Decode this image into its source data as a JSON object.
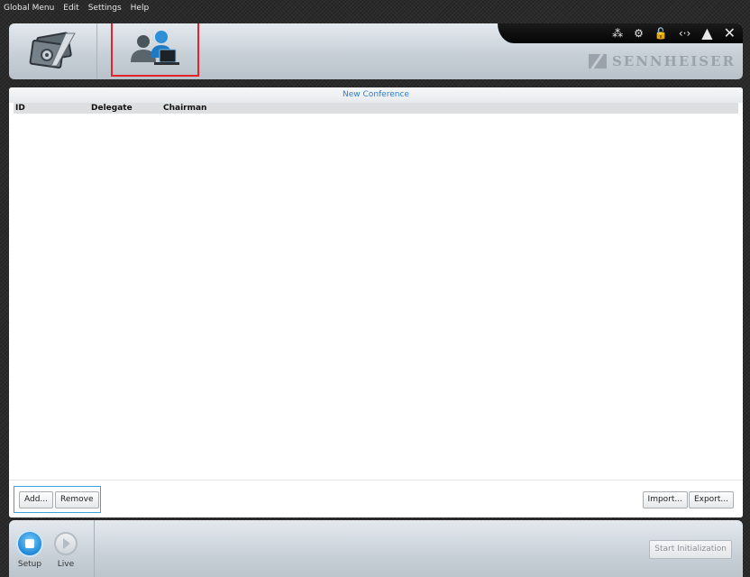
{
  "menu": [
    "Global Menu",
    "Edit",
    "Settings",
    "Help"
  ],
  "header": {
    "brand": "SENNHEISER",
    "status_icons": [
      "speaker-signal-icon",
      "gears-icon",
      "unlock-icon",
      "code-brackets-icon",
      "triangle-icon",
      "close-icon"
    ]
  },
  "panel": {
    "title": "New Conference",
    "columns": [
      "ID",
      "Delegate",
      "Chairman"
    ],
    "rows": []
  },
  "footer": {
    "add_label": "Add...",
    "remove_label": "Remove",
    "import_label": "Import...",
    "export_label": "Export..."
  },
  "bottom": {
    "setup_label": "Setup",
    "live_label": "Live",
    "start_label": "Start Initialization"
  },
  "colors": {
    "accent_blue": "#2a7fd4",
    "selection_red": "#e3252b",
    "selection_blue": "#3aa0e0"
  }
}
